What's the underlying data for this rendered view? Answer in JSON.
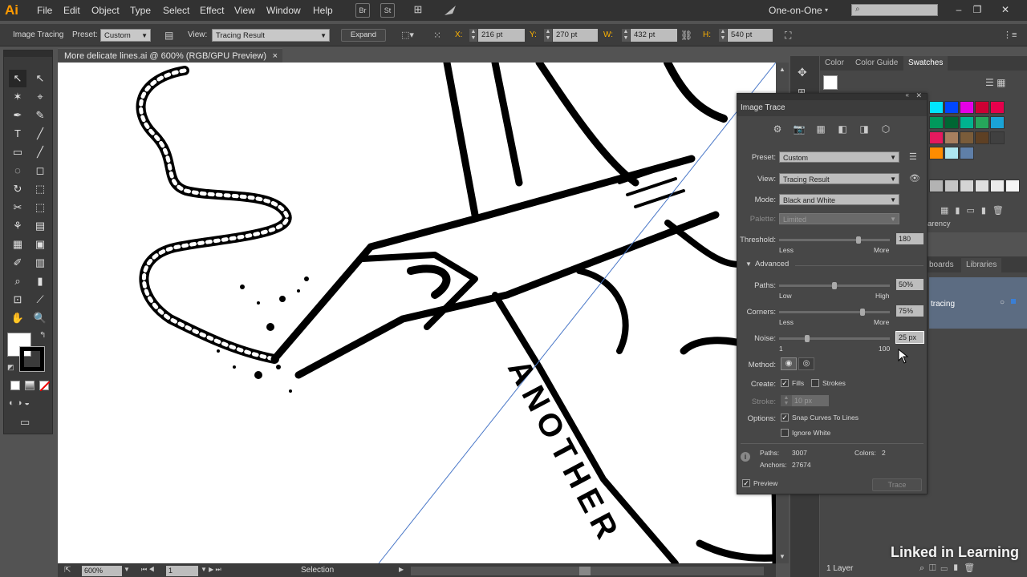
{
  "app": {
    "logo": "Ai"
  },
  "menu": [
    "File",
    "Edit",
    "Object",
    "Type",
    "Select",
    "Effect",
    "View",
    "Window",
    "Help"
  ],
  "menu_badges": {
    "br": "Br",
    "st": "St",
    "arrange": "⊞"
  },
  "workspace": "One-on-One",
  "search": {
    "placeholder": ""
  },
  "window_controls": {
    "minimize": "–",
    "restore": "❐",
    "close": "✕"
  },
  "controlbar": {
    "mode_label": "Image Tracing",
    "preset_label": "Preset:",
    "preset_value": "Custom",
    "view_label": "View:",
    "view_value": "Tracing Result",
    "expand_label": "Expand",
    "x_label": "X:",
    "x_value": "216 pt",
    "y_label": "Y:",
    "y_value": "270 pt",
    "w_label": "W:",
    "w_value": "432 pt",
    "h_label": "H:",
    "h_value": "540 pt"
  },
  "document_tab": {
    "title": "More delicate lines.ai @ 600% (RGB/GPU Preview)",
    "close": "×"
  },
  "toolbox": [
    "↖",
    "↖",
    "✶",
    "⌖",
    "✒",
    "✎",
    "T",
    "╱",
    "▭",
    "╱",
    "◌",
    "◻",
    "↻",
    "⬚",
    "✂",
    "⬚",
    "⚘",
    "▤",
    "▦",
    "▣",
    "✐",
    "▥",
    "⌕",
    "▮",
    "✋",
    "🔍"
  ],
  "statusbar": {
    "zoom": "600%",
    "page": "1",
    "tool": "Selection"
  },
  "swatches_panel": {
    "tabs": [
      "Color",
      "Color Guide",
      "Swatches"
    ],
    "colors": [
      "#00e5ff",
      "#0047ff",
      "#e600e6",
      "#cc0033",
      "#e6004c",
      "#00995c",
      "#006633",
      "#00b38f",
      "#26a65b",
      "#1aa3d6",
      "#e6195e",
      "#a87f5f",
      "#7a5c3a",
      "#5e4024",
      "#404040",
      "#ff8c00",
      "#aee6f0",
      "#5f7fa8"
    ],
    "grays": [
      "#b3b3b3",
      "#c4c4c4",
      "#d4d4d4",
      "#e0e0e0",
      "#ebebeb",
      "#f5f5f5"
    ]
  },
  "side_tabs": {
    "transparency": "arency",
    "artboards": "boards",
    "libraries": "Libraries"
  },
  "layers": {
    "layer_name": "tracing",
    "count": "1 Layer"
  },
  "image_trace": {
    "title": "Image Trace",
    "preset_label": "Preset:",
    "preset_value": "Custom",
    "view_label": "View:",
    "view_value": "Tracing Result",
    "mode_label": "Mode:",
    "mode_value": "Black and White",
    "palette_label": "Palette:",
    "palette_value": "Limited",
    "threshold_label": "Threshold:",
    "threshold_value": "180",
    "threshold_fraction": 0.72,
    "threshold_min": "Less",
    "threshold_max": "More",
    "advanced_label": "Advanced",
    "paths_label": "Paths:",
    "paths_value": "50%",
    "paths_fraction": 0.5,
    "paths_min": "Low",
    "paths_max": "High",
    "corners_label": "Corners:",
    "corners_value": "75%",
    "corners_fraction": 0.75,
    "corners_min": "Less",
    "corners_max": "More",
    "noise_label": "Noise:",
    "noise_value": "25 px",
    "noise_fraction": 0.25,
    "noise_min": "1",
    "noise_max": "100",
    "method_label": "Method:",
    "create_label": "Create:",
    "fills_label": "Fills",
    "strokes_label": "Strokes",
    "stroke_label": "Stroke:",
    "stroke_value": "10 px",
    "options_label": "Options:",
    "snap_label": "Snap Curves To Lines",
    "ignore_white_label": "Ignore White",
    "stats_paths_label": "Paths:",
    "stats_paths_value": "3007",
    "stats_anchors_label": "Anchors:",
    "stats_anchors_value": "27674",
    "stats_colors_label": "Colors:",
    "stats_colors_value": "2",
    "preview_label": "Preview",
    "trace_button": "Trace"
  },
  "artwork_text": "ANOTHER",
  "watermark": "Linked in Learning"
}
